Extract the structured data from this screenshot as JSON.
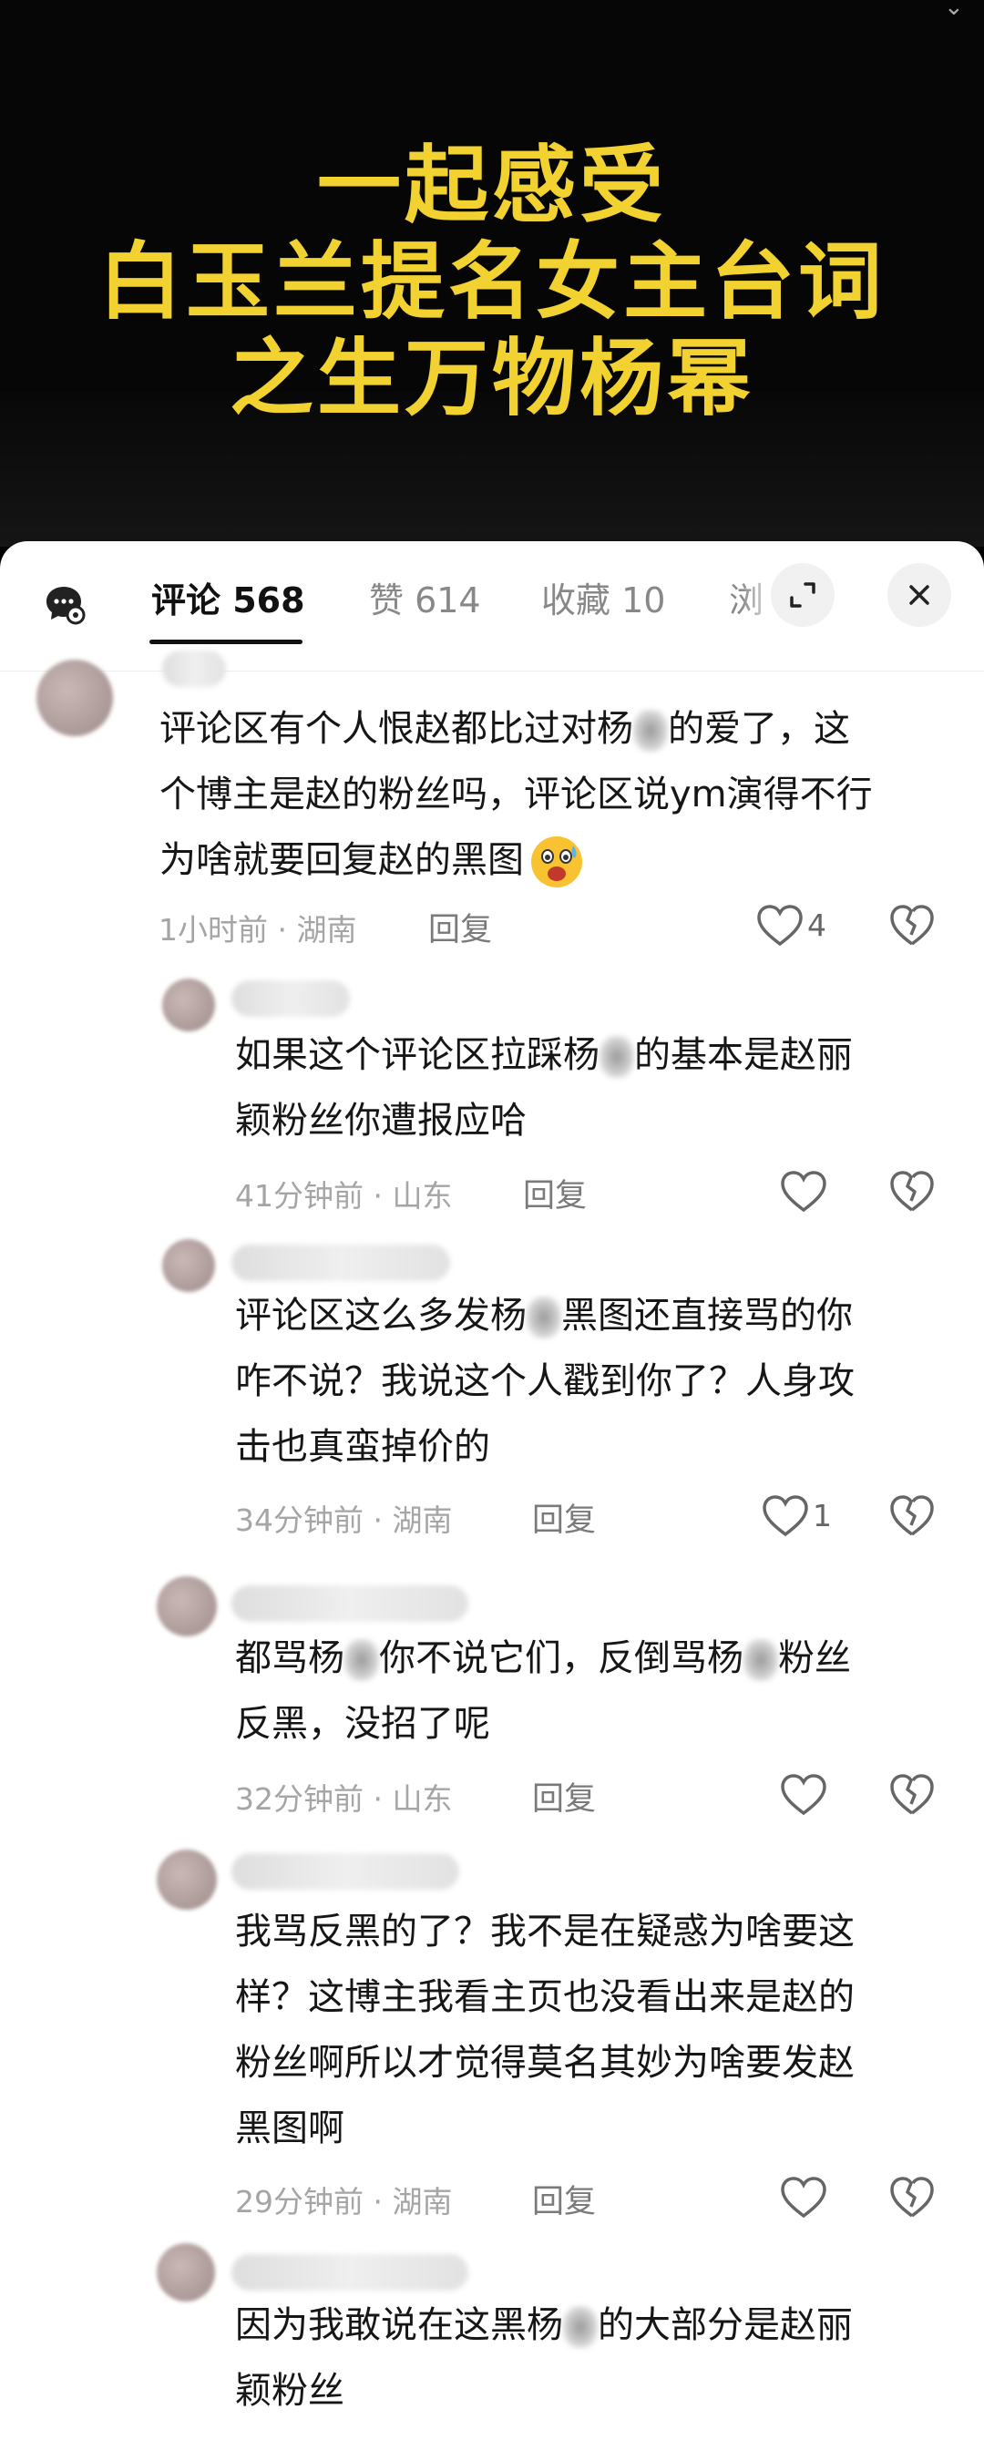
{
  "video": {
    "title_lines": [
      "一起感受",
      "白玉兰提名女主台词",
      "之生万物杨幂"
    ]
  },
  "comment_panel": {
    "tabs": [
      {
        "label": "评论 568"
      },
      {
        "label": "赞 614"
      },
      {
        "label": "收藏 10"
      },
      {
        "label": "浏"
      }
    ],
    "expand_icon": "expand-icon",
    "close_icon": "close-icon",
    "menu_icon": "chat-settings-icon"
  },
  "comments": [
    {
      "lines": [
        "评论区有个人恨赵都比过对杨",
        "的爱了，这",
        "个博主是赵的粉丝吗，评论区说ym演得不行",
        "为啥就要回复赵的黑图"
      ],
      "time": "1小时前",
      "location": "湖南",
      "reply_label": "回复",
      "likes": "4"
    },
    {
      "lines": [
        "如果这个评论区拉踩杨",
        "的基本是赵丽",
        "颖粉丝你遭报应哈"
      ],
      "time": "41分钟前",
      "location": "山东",
      "reply_label": "回复",
      "likes": ""
    },
    {
      "lines": [
        "评论区这么多发杨",
        "黑图还直接骂的你",
        "咋不说？我说这个人戳到你了？人身攻",
        "击也真蛮掉价的"
      ],
      "time": "34分钟前",
      "location": "湖南",
      "reply_label": "回复",
      "likes": "1"
    },
    {
      "lines": [
        "都骂杨",
        "你不说它们，反倒骂杨",
        "粉丝",
        "反黑，没招了呢"
      ],
      "time": "32分钟前",
      "location": "山东",
      "reply_label": "回复",
      "likes": ""
    },
    {
      "lines": [
        "我骂反黑的了？我不是在疑惑为啥要这",
        "样？这博主我看主页也没看出来是赵的",
        "粉丝啊所以才觉得莫名其妙为啥要发赵",
        "黑图啊"
      ],
      "time": "29分钟前",
      "location": "湖南",
      "reply_label": "回复",
      "likes": ""
    },
    {
      "lines": [
        "因为我敢说在这黑杨",
        "的大部分是赵丽",
        "颖粉丝"
      ]
    }
  ],
  "separator": " · ",
  "icons": {
    "like": "heart-outline-icon",
    "dislike": "broken-heart-icon",
    "emoji": "shocked-face-emoji"
  }
}
